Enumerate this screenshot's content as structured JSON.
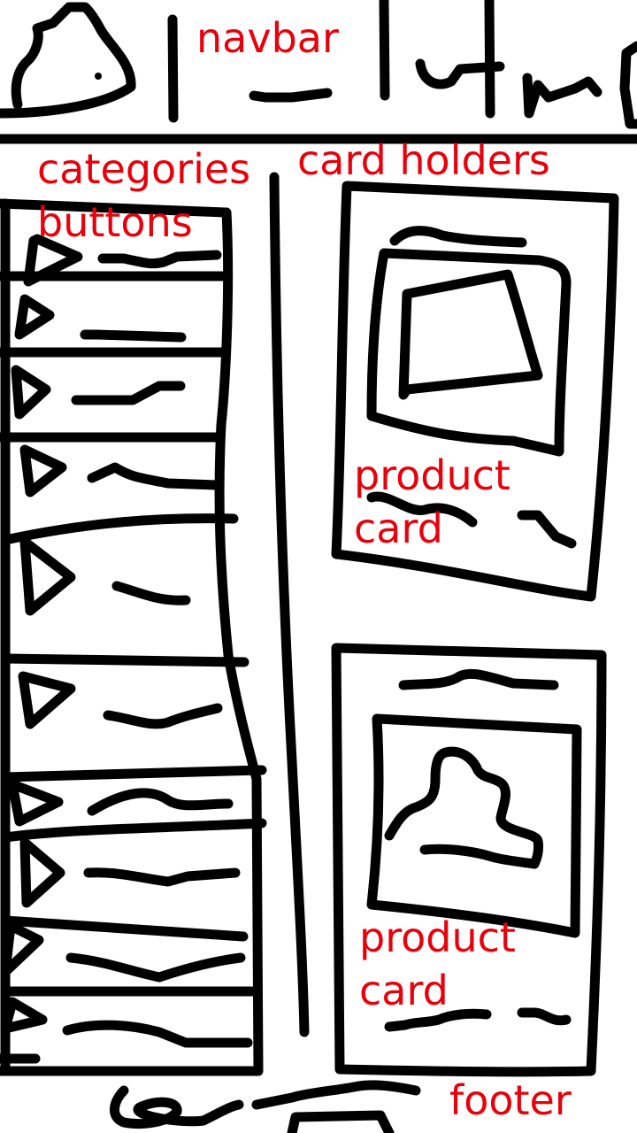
{
  "annotations": {
    "navbar": "navbar",
    "categories": [
      "categories",
      "buttons"
    ],
    "card_holders": "card holders",
    "product_card_1": [
      "product",
      "card"
    ],
    "product_card_2": [
      "product",
      "card"
    ],
    "footer": "footer"
  },
  "colors": {
    "annotation": "#e8000b",
    "ink": "#000000",
    "background": "#ffffff"
  },
  "icons": [
    "logo-icon",
    "play-triangle-icon",
    "image-placeholder-icon",
    "person-placeholder-icon"
  ],
  "category_button_count": 11
}
